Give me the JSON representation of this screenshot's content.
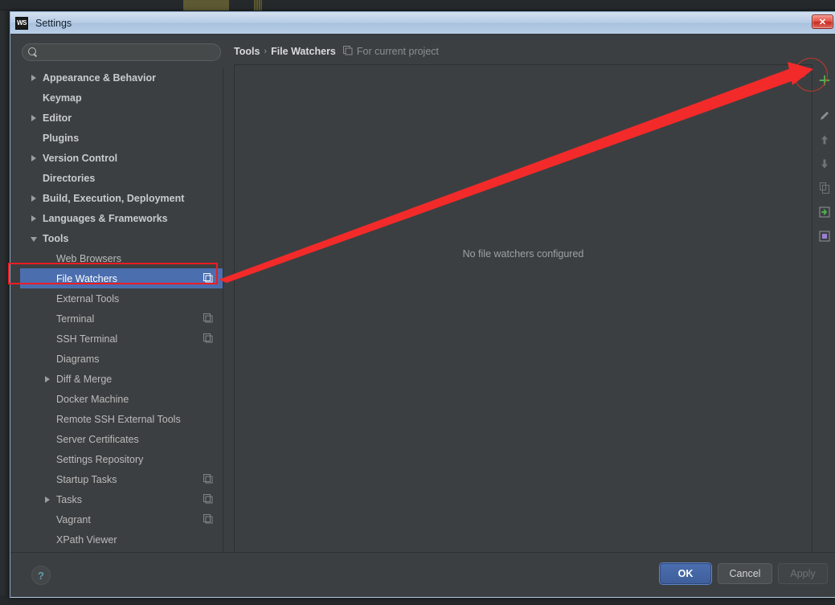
{
  "window": {
    "app_badge": "WS",
    "title": "Settings",
    "close_label": "✕"
  },
  "search": {
    "value": "",
    "placeholder": "",
    "icon": "search-icon"
  },
  "sidebar": {
    "items": [
      {
        "label": "Appearance & Behavior",
        "level": 0,
        "twisty": "collapsed",
        "badge": "none",
        "selected": false
      },
      {
        "label": "Keymap",
        "level": 0,
        "twisty": "none",
        "badge": "none",
        "selected": false
      },
      {
        "label": "Editor",
        "level": 0,
        "twisty": "collapsed",
        "badge": "none",
        "selected": false
      },
      {
        "label": "Plugins",
        "level": 0,
        "twisty": "none",
        "badge": "none",
        "selected": false
      },
      {
        "label": "Version Control",
        "level": 0,
        "twisty": "collapsed",
        "badge": "none",
        "selected": false
      },
      {
        "label": "Directories",
        "level": 0,
        "twisty": "none",
        "badge": "none",
        "selected": false
      },
      {
        "label": "Build, Execution, Deployment",
        "level": 0,
        "twisty": "collapsed",
        "badge": "none",
        "selected": false
      },
      {
        "label": "Languages & Frameworks",
        "level": 0,
        "twisty": "collapsed",
        "badge": "none",
        "selected": false
      },
      {
        "label": "Tools",
        "level": 0,
        "twisty": "expanded",
        "badge": "none",
        "selected": false
      },
      {
        "label": "Web Browsers",
        "level": 1,
        "twisty": "none",
        "badge": "none",
        "selected": false
      },
      {
        "label": "File Watchers",
        "level": 1,
        "twisty": "none",
        "badge": "project",
        "selected": true
      },
      {
        "label": "External Tools",
        "level": 1,
        "twisty": "none",
        "badge": "none",
        "selected": false
      },
      {
        "label": "Terminal",
        "level": 1,
        "twisty": "none",
        "badge": "project",
        "selected": false
      },
      {
        "label": "SSH Terminal",
        "level": 1,
        "twisty": "none",
        "badge": "project",
        "selected": false
      },
      {
        "label": "Diagrams",
        "level": 1,
        "twisty": "none",
        "badge": "none",
        "selected": false
      },
      {
        "label": "Diff & Merge",
        "level": 1,
        "twisty": "collapsed",
        "badge": "none",
        "selected": false
      },
      {
        "label": "Docker Machine",
        "level": 1,
        "twisty": "none",
        "badge": "none",
        "selected": false
      },
      {
        "label": "Remote SSH External Tools",
        "level": 1,
        "twisty": "none",
        "badge": "none",
        "selected": false
      },
      {
        "label": "Server Certificates",
        "level": 1,
        "twisty": "none",
        "badge": "none",
        "selected": false
      },
      {
        "label": "Settings Repository",
        "level": 1,
        "twisty": "none",
        "badge": "none",
        "selected": false
      },
      {
        "label": "Startup Tasks",
        "level": 1,
        "twisty": "none",
        "badge": "project",
        "selected": false
      },
      {
        "label": "Tasks",
        "level": 1,
        "twisty": "collapsed",
        "badge": "project",
        "selected": false
      },
      {
        "label": "Vagrant",
        "level": 1,
        "twisty": "none",
        "badge": "project",
        "selected": false
      },
      {
        "label": "XPath Viewer",
        "level": 1,
        "twisty": "none",
        "badge": "none",
        "selected": false
      }
    ]
  },
  "content": {
    "breadcrumb": {
      "parent": "Tools",
      "separator": "›",
      "current": "File Watchers"
    },
    "scope_icon": "project-scope-icon",
    "scope_text": "For current project",
    "empty_state": "No file watchers configured"
  },
  "toolbar": {
    "buttons": [
      {
        "name": "add-button",
        "icon": "plus-icon",
        "title": "Add",
        "color": "#4caf50",
        "enabled": true
      },
      {
        "name": "edit-button",
        "icon": "pencil-icon",
        "title": "Edit",
        "color": "#8b8f91",
        "enabled": false
      },
      {
        "name": "move-up-button",
        "icon": "arrow-up-icon",
        "title": "Move Up",
        "color": "#6f7375",
        "enabled": false
      },
      {
        "name": "move-down-button",
        "icon": "arrow-down-icon",
        "title": "Move Down",
        "color": "#6f7375",
        "enabled": false
      },
      {
        "name": "copy-button",
        "icon": "copy-icon",
        "title": "Copy",
        "color": "#6f7375",
        "enabled": false
      },
      {
        "name": "import-button",
        "icon": "import-icon",
        "title": "Import",
        "color": "#4caf50",
        "enabled": true
      },
      {
        "name": "export-button",
        "icon": "export-icon",
        "title": "Export",
        "color": "#9b7fd4",
        "enabled": true
      }
    ]
  },
  "footer": {
    "help_label": "?",
    "ok_label": "OK",
    "cancel_label": "Cancel",
    "apply_label": "Apply"
  },
  "annotations": {
    "highlight_color": "#ee1c25",
    "arrow_color": "#f32a2a",
    "circle_color": "#c0392b",
    "arrow_from": "File Watchers sidebar row",
    "arrow_to": "Add (+) toolbar button"
  }
}
